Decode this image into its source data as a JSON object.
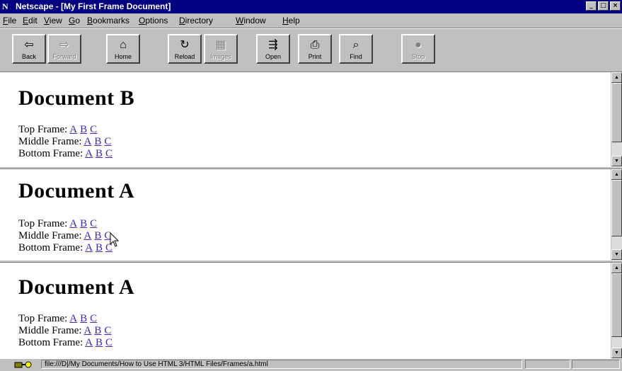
{
  "window": {
    "title": "Netscape - [My First Frame Document]",
    "app_icon": "netscape-n-icon",
    "buttons": [
      "minimize-icon",
      "maximize-icon",
      "close-icon"
    ]
  },
  "menu": [
    "File",
    "Edit",
    "View",
    "Go",
    "Bookmarks",
    "Options",
    "Directory",
    "Window",
    "Help"
  ],
  "toolbar": {
    "buttons": [
      {
        "label": "Back",
        "icon": "back-arrow-icon",
        "enabled": true
      },
      {
        "label": "Forward",
        "icon": "forward-arrow-icon",
        "enabled": false
      },
      {
        "label": "Home",
        "icon": "home-icon",
        "enabled": true
      },
      {
        "label": "Reload",
        "icon": "reload-icon",
        "enabled": true
      },
      {
        "label": "Images",
        "icon": "images-icon",
        "enabled": false
      },
      {
        "label": "Open",
        "icon": "open-icon",
        "enabled": true
      },
      {
        "label": "Print",
        "icon": "print-icon",
        "enabled": true
      },
      {
        "label": "Find",
        "icon": "find-icon",
        "enabled": true
      },
      {
        "label": "Stop",
        "icon": "stop-icon",
        "enabled": false
      }
    ]
  },
  "frames": [
    {
      "heading": "Document B",
      "rows": [
        {
          "label": "Top Frame:",
          "links": [
            "A",
            "B",
            "C"
          ]
        },
        {
          "label": "Middle Frame:",
          "links": [
            "A",
            "B",
            "C"
          ]
        },
        {
          "label": "Bottom Frame:",
          "links": [
            "A",
            "B",
            "C"
          ]
        }
      ]
    },
    {
      "heading": "Document A",
      "rows": [
        {
          "label": "Top Frame:",
          "links": [
            "A",
            "B",
            "C"
          ]
        },
        {
          "label": "Middle Frame:",
          "links": [
            "A",
            "B",
            "C"
          ]
        },
        {
          "label": "Bottom Frame:",
          "links": [
            "A",
            "B",
            "C"
          ]
        }
      ]
    },
    {
      "heading": "Document A",
      "rows": [
        {
          "label": "Top Frame:",
          "links": [
            "A",
            "B",
            "C"
          ]
        },
        {
          "label": "Middle Frame:",
          "links": [
            "A",
            "B",
            "C"
          ]
        },
        {
          "label": "Bottom Frame:",
          "links": [
            "A",
            "B",
            "C"
          ]
        }
      ]
    }
  ],
  "status": {
    "text": "file:///D|/My Documents/How to Use HTML 3/HTML Files/Frames/a.html",
    "security_icon": "security-key-icon"
  },
  "colors": {
    "titlebar": "#000080",
    "link": "#3b2ab8",
    "chrome": "#c0c0c0"
  }
}
